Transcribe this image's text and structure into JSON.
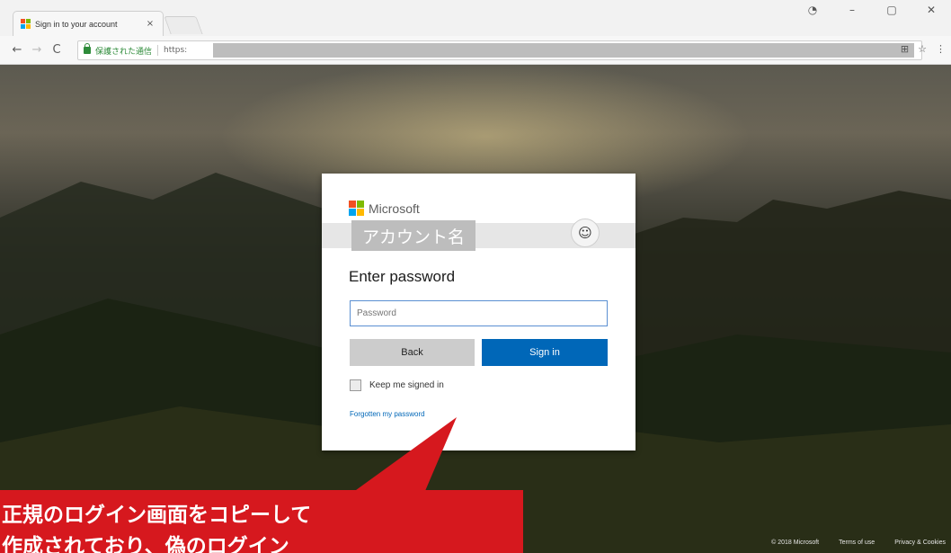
{
  "browser": {
    "tab_title": "Sign in to your account",
    "tab_close": "×",
    "secure_label": "保護された通信",
    "url": "https:",
    "window_controls": [
      "–",
      "▢",
      "✕"
    ],
    "toolbar_icons": [
      "translate-icon",
      "star-icon",
      "menu-icon"
    ]
  },
  "login": {
    "brand": "Microsoft",
    "account_name": "アカウント名",
    "heading": "Enter password",
    "password_placeholder": "Password",
    "back_label": "Back",
    "signin_label": "Sign in",
    "keep_signed_in": "Keep me signed in",
    "forgot_link": "Forgotten my password"
  },
  "footer": {
    "copyright": "© 2018 Microsoft",
    "terms": "Terms of use",
    "privacy": "Privacy & Cookies"
  },
  "callout": {
    "line1": "正規のログイン画面をコピーして",
    "line2": "作成されており、偽のログイン"
  },
  "colors": {
    "ms_red": "#f25022",
    "ms_green": "#7fba00",
    "ms_blue": "#00a4ef",
    "ms_yellow": "#ffb900",
    "signin_blue": "#0067b8",
    "callout_red": "#d6181e"
  }
}
